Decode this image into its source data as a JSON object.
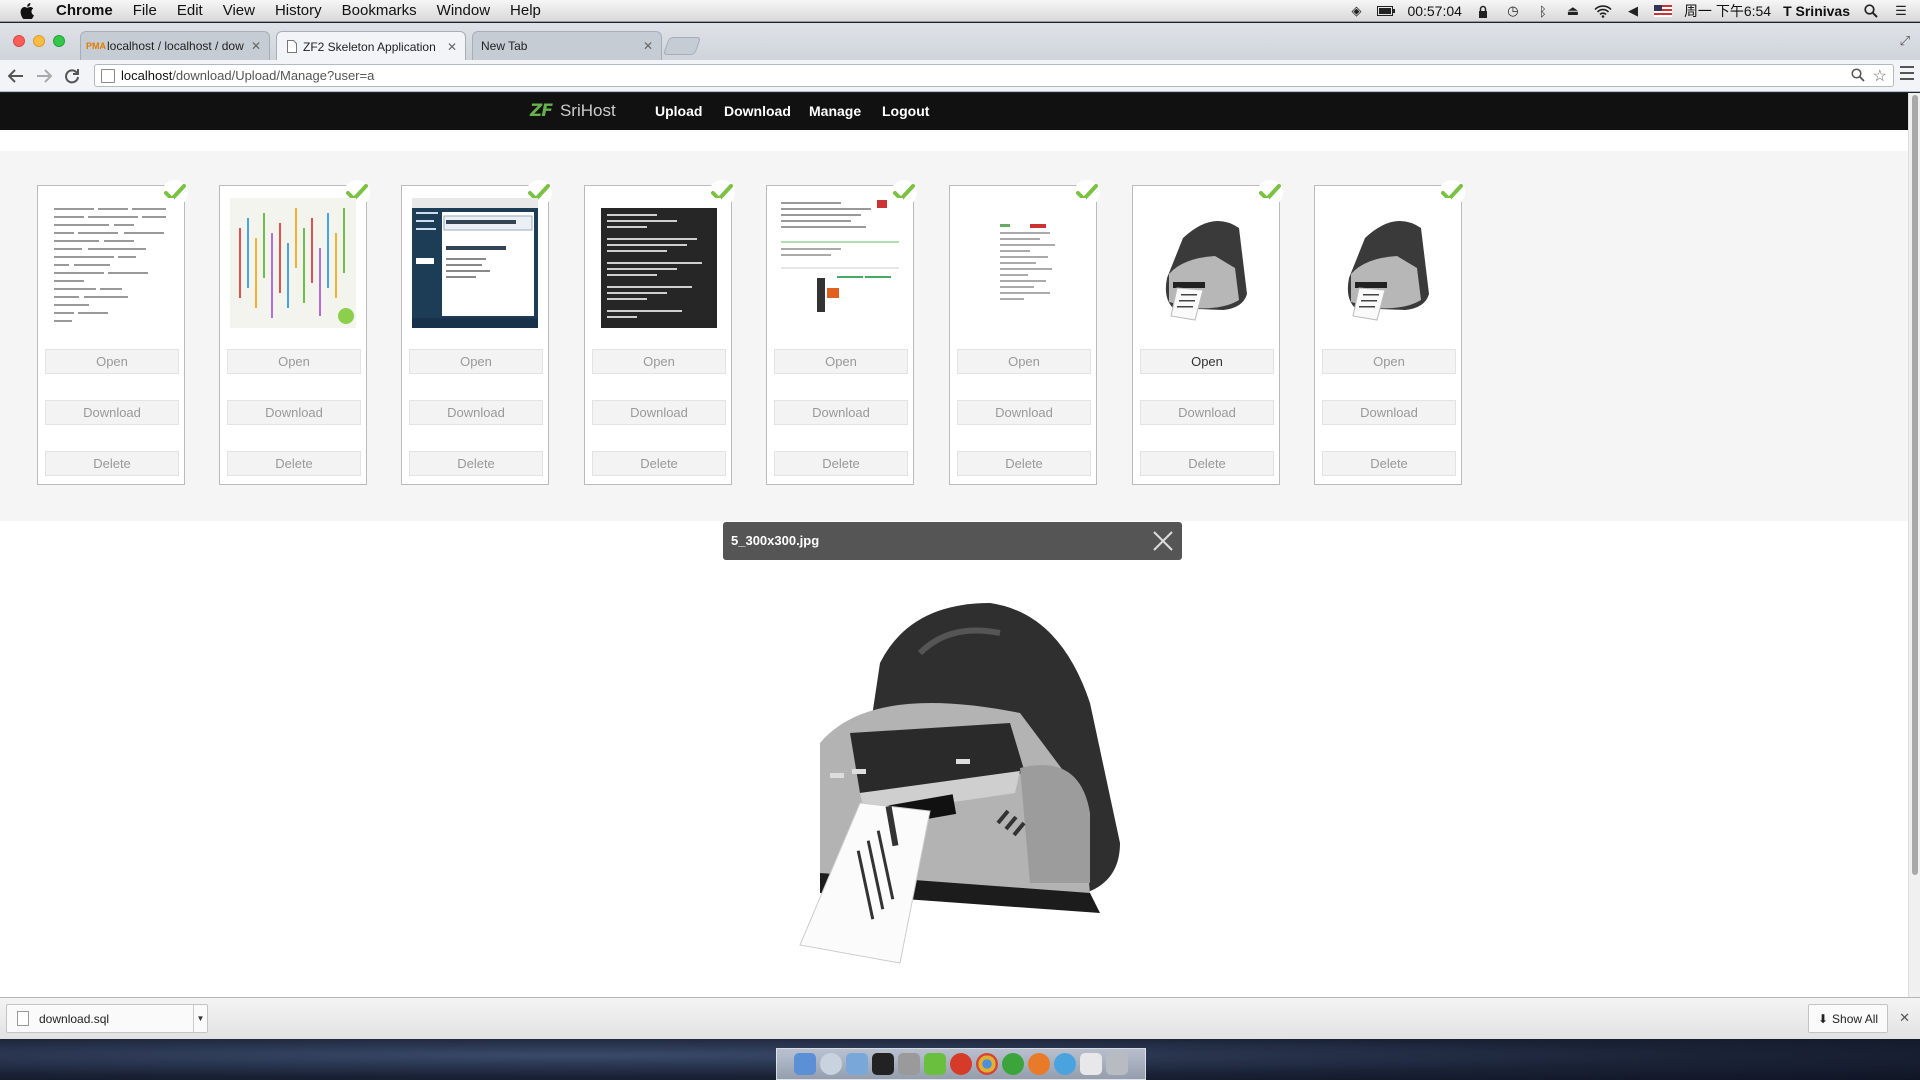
{
  "menubar": {
    "items": [
      "Chrome",
      "File",
      "Edit",
      "View",
      "History",
      "Bookmarks",
      "Window",
      "Help"
    ],
    "clock": "00:57:04",
    "datetime": "周一 下午6:54",
    "user": "T Srinivas"
  },
  "tabs": [
    {
      "label": "localhost / localhost / dow",
      "favicon": "PMA"
    },
    {
      "label": "ZF2 Skeleton Application",
      "favicon": "page-icon"
    },
    {
      "label": "New Tab",
      "favicon": ""
    }
  ],
  "address": {
    "host": "localhost",
    "path": "/download/Upload/Manage?user=a"
  },
  "navbar": {
    "brand_mark": "ZF",
    "brand_name": "SriHost",
    "links": [
      "Upload",
      "Download",
      "Manage",
      "Logout"
    ]
  },
  "gallery": {
    "cards": [
      {
        "open_label": "Open",
        "download_label": "Download",
        "delete_label": "Delete",
        "thumb": "text-document"
      },
      {
        "open_label": "Open",
        "download_label": "Download",
        "delete_label": "Delete",
        "thumb": "colorful-code"
      },
      {
        "open_label": "Open",
        "download_label": "Download",
        "delete_label": "Delete",
        "thumb": "documentation-page"
      },
      {
        "open_label": "Open",
        "download_label": "Download",
        "delete_label": "Delete",
        "thumb": "dark-terminal"
      },
      {
        "open_label": "Open",
        "download_label": "Download",
        "delete_label": "Delete",
        "thumb": "web-page"
      },
      {
        "open_label": "Open",
        "download_label": "Download",
        "delete_label": "Delete",
        "thumb": "data-table"
      },
      {
        "open_label": "Open",
        "download_label": "Download",
        "delete_label": "Delete",
        "thumb": "label-printer",
        "hovered": true
      },
      {
        "open_label": "Open",
        "download_label": "Download",
        "delete_label": "Delete",
        "thumb": "label-printer"
      }
    ]
  },
  "preview": {
    "caption": "5_300x300.jpg",
    "image": "label-printer"
  },
  "download_shelf": {
    "filename": "download.sql",
    "show_all": "Show All"
  },
  "colors": {
    "navbar_bg": "#111111",
    "brand_green": "#68b04d",
    "check_green": "#7cc144",
    "caption_bg": "#555555"
  }
}
